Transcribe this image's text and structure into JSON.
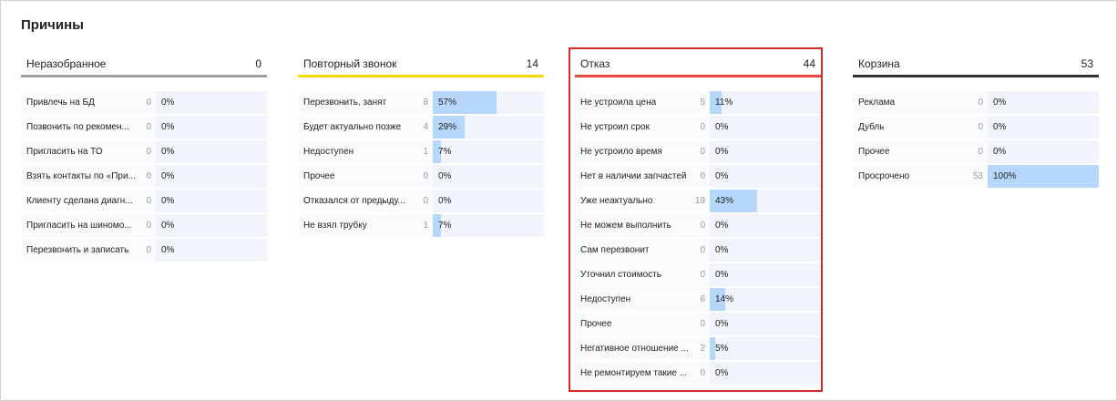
{
  "page_title": "Причины",
  "columns": [
    {
      "title": "Неразобранное",
      "total": "0",
      "accent": "#a0a0a0",
      "rows": [
        {
          "label": "Привлечь на БД",
          "count": "0",
          "pct_label": "0%",
          "fraction": 0
        },
        {
          "label": "Позвонить по рекомен...",
          "count": "0",
          "pct_label": "0%",
          "fraction": 0
        },
        {
          "label": "Пригласить на ТО",
          "count": "0",
          "pct_label": "0%",
          "fraction": 0
        },
        {
          "label": "Взять контакты по «При...",
          "count": "0",
          "pct_label": "0%",
          "fraction": 0
        },
        {
          "label": "Клиенту сделана диагн...",
          "count": "0",
          "pct_label": "0%",
          "fraction": 0
        },
        {
          "label": "Пригласить на шиномо...",
          "count": "0",
          "pct_label": "0%",
          "fraction": 0
        },
        {
          "label": "Перезвонить и записать",
          "count": "0",
          "pct_label": "0%",
          "fraction": 0
        }
      ]
    },
    {
      "title": "Повторный звонок",
      "total": "14",
      "accent": "#f5d90a",
      "rows": [
        {
          "label": "Перезвонить, занят",
          "count": "8",
          "pct_label": "57%",
          "fraction": 0.57
        },
        {
          "label": "Будет актуально позже",
          "count": "4",
          "pct_label": "29%",
          "fraction": 0.29
        },
        {
          "label": "Недоступен",
          "count": "1",
          "pct_label": "7%",
          "fraction": 0.07
        },
        {
          "label": "Прочее",
          "count": "0",
          "pct_label": "0%",
          "fraction": 0
        },
        {
          "label": "Отказался от предыду...",
          "count": "0",
          "pct_label": "0%",
          "fraction": 0
        },
        {
          "label": "Не взял трубку",
          "count": "1",
          "pct_label": "7%",
          "fraction": 0.07
        }
      ]
    },
    {
      "title": "Отказ",
      "total": "44",
      "accent": "#e8493f",
      "rows": [
        {
          "label": "Не устроила цена",
          "count": "5",
          "pct_label": "11%",
          "fraction": 0.11
        },
        {
          "label": "Не устроил срок",
          "count": "0",
          "pct_label": "0%",
          "fraction": 0
        },
        {
          "label": "Не устроило время",
          "count": "0",
          "pct_label": "0%",
          "fraction": 0
        },
        {
          "label": "Нет в наличии запчастей",
          "count": "0",
          "pct_label": "0%",
          "fraction": 0
        },
        {
          "label": "Уже неактуально",
          "count": "19",
          "pct_label": "43%",
          "fraction": 0.43
        },
        {
          "label": "Не можем выполнить",
          "count": "0",
          "pct_label": "0%",
          "fraction": 0
        },
        {
          "label": "Сам перезвонит",
          "count": "0",
          "pct_label": "0%",
          "fraction": 0
        },
        {
          "label": "Уточнил стоимость",
          "count": "0",
          "pct_label": "0%",
          "fraction": 0
        },
        {
          "label": "Недоступен",
          "count": "6",
          "pct_label": "14%",
          "fraction": 0.14
        },
        {
          "label": "Прочее",
          "count": "0",
          "pct_label": "0%",
          "fraction": 0
        },
        {
          "label": "Негативное отношение ...",
          "count": "2",
          "pct_label": "5%",
          "fraction": 0.05
        },
        {
          "label": "Не ремонтируем такие ...",
          "count": "0",
          "pct_label": "0%",
          "fraction": 0
        }
      ]
    },
    {
      "title": "Корзина",
      "total": "53",
      "accent": "#333333",
      "rows": [
        {
          "label": "Реклама",
          "count": "0",
          "pct_label": "0%",
          "fraction": 0
        },
        {
          "label": "Дубль",
          "count": "0",
          "pct_label": "0%",
          "fraction": 0
        },
        {
          "label": "Прочее",
          "count": "0",
          "pct_label": "0%",
          "fraction": 0
        },
        {
          "label": "Просрочено",
          "count": "53",
          "pct_label": "100%",
          "fraction": 1
        }
      ]
    }
  ],
  "highlight_color": "#d62b2b"
}
